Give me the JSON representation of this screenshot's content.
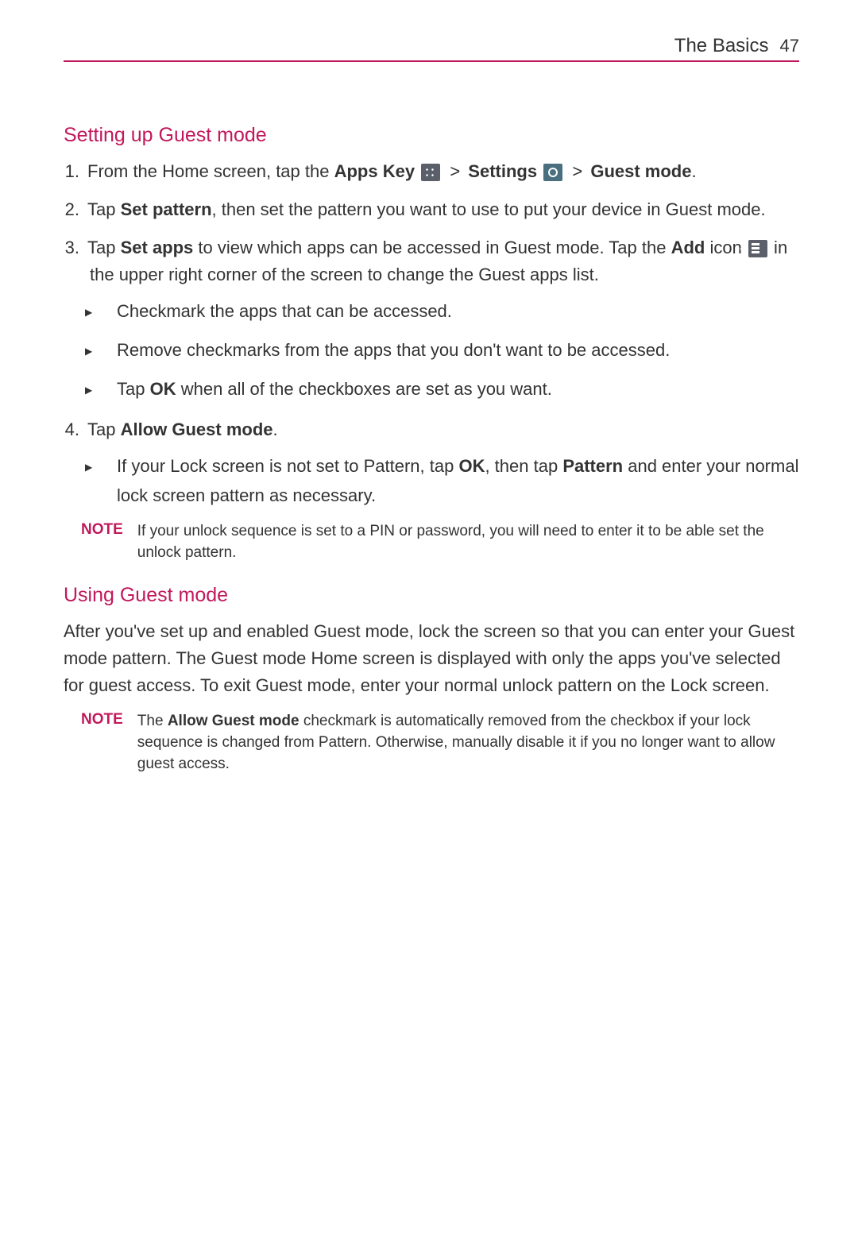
{
  "header": {
    "section": "The Basics",
    "page": "47"
  },
  "s1": {
    "heading": "Setting up Guest mode",
    "step1_a": "From the Home screen, tap the ",
    "step1_b": "Apps Key",
    "step1_c": "Settings",
    "step1_d": "Guest mode",
    "gt": ">",
    "period": ".",
    "step2_a": "Tap ",
    "step2_b": "Set pattern",
    "step2_c": ", then set the pattern you want to use to put your device in Guest mode.",
    "step3_a": "Tap ",
    "step3_b": "Set apps",
    "step3_c": " to view which apps can be accessed in Guest mode. Tap the ",
    "step3_d": "Add",
    "step3_e": " icon ",
    "step3_f": " in the upper right corner of the screen to change the Guest apps list.",
    "sub3_1": "Checkmark the apps that can be accessed.",
    "sub3_2": "Remove checkmarks from the apps that you don't want to be accessed.",
    "sub3_3a": "Tap ",
    "sub3_3b": "OK",
    "sub3_3c": " when all of the checkboxes are set as you want.",
    "step4_a": "Tap ",
    "step4_b": "Allow Guest mode",
    "step4_c": ".",
    "sub4_1a": "If your Lock screen is not set to Pattern, tap ",
    "sub4_1b": "OK",
    "sub4_1c": ", then tap ",
    "sub4_1d": "Pattern",
    "sub4_1e": " and enter your normal lock screen pattern as necessary.",
    "note_label": "NOTE",
    "note_text": "If your unlock sequence is set to a PIN or password, you will need to enter it to be able set the unlock pattern."
  },
  "s2": {
    "heading": "Using Guest mode",
    "para": "After you've set up and enabled Guest mode, lock the screen so that you can enter your Guest mode pattern. The Guest mode Home screen is displayed with only the apps you've selected for guest access. To exit Guest mode, enter your normal unlock pattern on the Lock screen.",
    "note_label": "NOTE",
    "note_a": "The ",
    "note_b": "Allow Guest mode",
    "note_c": " checkmark is automatically removed from the checkbox if your lock sequence is changed from Pattern.  Otherwise, manually disable it if you no longer want to allow guest access."
  }
}
